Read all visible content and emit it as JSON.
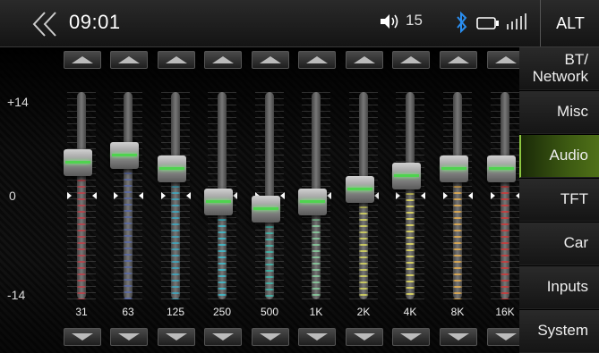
{
  "header": {
    "time": "09:01",
    "volume": "15",
    "alt_label": "ALT"
  },
  "icons": {
    "back": "double-chevron-left",
    "volume": "speaker-icon",
    "bluetooth": "bluetooth-icon",
    "battery": "battery-icon",
    "signal": "signal-icon"
  },
  "scale": {
    "top": "+14",
    "mid": "0",
    "bottom": "-14"
  },
  "equalizer": {
    "range": [
      -14,
      14
    ],
    "bands": [
      {
        "freq": "31",
        "value": 5,
        "color": "#c0404a"
      },
      {
        "freq": "63",
        "value": 6,
        "color": "#5a6aa8"
      },
      {
        "freq": "125",
        "value": 4,
        "color": "#3fa8c0"
      },
      {
        "freq": "250",
        "value": -1,
        "color": "#3ec0d0"
      },
      {
        "freq": "500",
        "value": -2,
        "color": "#3ebcb0"
      },
      {
        "freq": "1K",
        "value": -1,
        "color": "#8ad0a0"
      },
      {
        "freq": "2K",
        "value": 1,
        "color": "#d8d860"
      },
      {
        "freq": "4K",
        "value": 3,
        "color": "#e8e060"
      },
      {
        "freq": "8K",
        "value": 4,
        "color": "#e8b050"
      },
      {
        "freq": "16K",
        "value": 4,
        "color": "#d03a3a"
      }
    ]
  },
  "sidebar": {
    "items": [
      {
        "label": "BT/ Network",
        "active": false
      },
      {
        "label": "Misc",
        "active": false
      },
      {
        "label": "Audio",
        "active": true
      },
      {
        "label": "TFT",
        "active": false
      },
      {
        "label": "Car",
        "active": false
      },
      {
        "label": "Inputs",
        "active": false
      },
      {
        "label": "System",
        "active": false
      }
    ]
  }
}
